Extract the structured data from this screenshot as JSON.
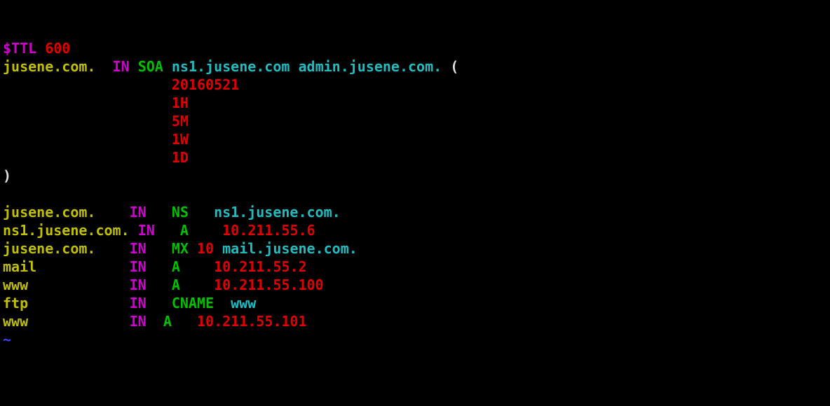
{
  "ttl": {
    "directive": "$TTL",
    "value": "600"
  },
  "soa": {
    "origin": "jusene.com.",
    "cls": "IN",
    "type": "SOA",
    "ns": "ns1.jusene.com",
    "contact": "admin.jusene.com.",
    "open": "(",
    "serial": "20160521",
    "refresh": "1H",
    "retry": "5M",
    "expire": "1W",
    "minimum": "1D",
    "close": ")"
  },
  "r1": {
    "name": "jusene.com.",
    "cls": "IN",
    "type": "NS",
    "value": "ns1.jusene.com."
  },
  "r2": {
    "name": "ns1.jusene.com.",
    "cls": "IN",
    "type": "A",
    "value": "10.211.55.6"
  },
  "r3": {
    "name": "jusene.com.",
    "cls": "IN",
    "type": "MX",
    "pri": "10",
    "value": "mail.jusene.com."
  },
  "r4": {
    "name": "mail",
    "cls": "IN",
    "type": "A",
    "value": "10.211.55.2"
  },
  "r5": {
    "name": "www",
    "cls": "IN",
    "type": "A",
    "value": "10.211.55.100"
  },
  "r6": {
    "name": "ftp",
    "cls": "IN",
    "type": "CNAME",
    "value": "www"
  },
  "r7": {
    "name": "www",
    "cls": "IN",
    "type": "A",
    "value": "10.211.55.101"
  },
  "tilde": "~"
}
